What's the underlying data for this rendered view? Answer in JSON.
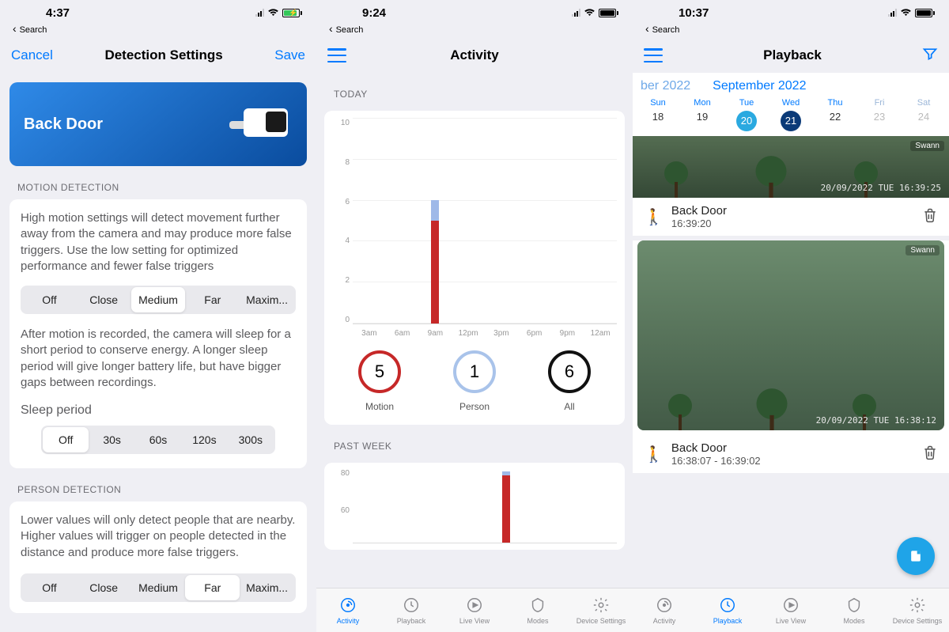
{
  "screen1": {
    "status_time": "4:37",
    "back_link": "Search",
    "nav_cancel": "Cancel",
    "nav_title": "Detection Settings",
    "nav_save": "Save",
    "camera_name": "Back Door",
    "motion": {
      "header": "MOTION DETECTION",
      "desc": "High motion settings will detect movement further away from the camera and may produce more false triggers. Use the low setting for optimized performance and fewer false triggers",
      "options": [
        "Off",
        "Close",
        "Medium",
        "Far",
        "Maxim..."
      ],
      "selected": "Medium",
      "sleep_desc": "After motion is recorded, the camera will sleep for a short period to conserve energy.  A longer sleep period will give longer battery life, but have bigger gaps between recordings.",
      "sleep_label": "Sleep period",
      "sleep_options": [
        "Off",
        "30s",
        "60s",
        "120s",
        "300s"
      ],
      "sleep_selected": "Off"
    },
    "person": {
      "header": "PERSON DETECTION",
      "desc": "Lower values will only detect people that are nearby. Higher values will trigger on people detected in the distance and produce more false triggers.",
      "options": [
        "Off",
        "Close",
        "Medium",
        "Far",
        "Maxim..."
      ],
      "selected": "Far"
    }
  },
  "screen2": {
    "status_time": "9:24",
    "back_link": "Search",
    "nav_title": "Activity",
    "today_header": "TODAY",
    "pastweek_header": "PAST WEEK",
    "stats": {
      "motion": {
        "value": "5",
        "label": "Motion",
        "color": "#c62828"
      },
      "person": {
        "value": "1",
        "label": "Person",
        "color": "#a9c3ea"
      },
      "all": {
        "value": "6",
        "label": "All",
        "color": "#111"
      }
    },
    "tabs": [
      "Activity",
      "Playback",
      "Live View",
      "Modes",
      "Device Settings"
    ],
    "active_tab": "Activity"
  },
  "chart_data": [
    {
      "type": "bar",
      "title": "TODAY",
      "categories": [
        "3am",
        "6am",
        "9am",
        "12pm",
        "3pm",
        "6pm",
        "9pm",
        "12am"
      ],
      "ylim": [
        0,
        10
      ],
      "yticks": [
        0,
        2,
        4,
        6,
        8,
        10
      ],
      "series": [
        {
          "name": "Motion",
          "color": "#c62828",
          "values": [
            0,
            0,
            5,
            0,
            0,
            0,
            0,
            0
          ]
        },
        {
          "name": "Person",
          "color": "#9fb9e8",
          "values": [
            0,
            0,
            1,
            0,
            0,
            0,
            0,
            0
          ]
        }
      ]
    },
    {
      "type": "bar",
      "title": "PAST WEEK",
      "categories": [],
      "ylim": [
        0,
        80
      ],
      "yticks": [
        60,
        80
      ],
      "series": [
        {
          "name": "Motion",
          "color": "#c62828",
          "values": [
            72
          ]
        },
        {
          "name": "Person",
          "color": "#9fb9e8",
          "values": [
            5
          ]
        }
      ]
    }
  ],
  "screen3": {
    "status_time": "10:37",
    "back_link": "Search",
    "nav_title": "Playback",
    "month_prev": "ber 2022",
    "month_curr": "September 2022",
    "days": [
      {
        "dow": "Sun",
        "n": "18",
        "state": "norm"
      },
      {
        "dow": "Mon",
        "n": "19",
        "state": "norm"
      },
      {
        "dow": "Tue",
        "n": "20",
        "state": "circle-light"
      },
      {
        "dow": "Wed",
        "n": "21",
        "state": "circle-dark"
      },
      {
        "dow": "Thu",
        "n": "22",
        "state": "norm"
      },
      {
        "dow": "Fri",
        "n": "23",
        "state": "dim"
      },
      {
        "dow": "Sat",
        "n": "24",
        "state": "dim"
      }
    ],
    "clips": [
      {
        "thumb_ts": "20/09/2022 TUE 16:39:25",
        "name": "Back Door",
        "time": "16:39:20",
        "brand": "Swann",
        "big": false,
        "bg": "#3a4d3f"
      },
      {
        "thumb_ts": "20/09/2022 TUE 16:38:12",
        "name": "Back Door",
        "time": "16:38:07 - 16:39:02",
        "brand": "Swann",
        "big": true,
        "bg": "#6a8b78"
      }
    ],
    "tabs": [
      "Activity",
      "Playback",
      "Live View",
      "Modes",
      "Device Settings"
    ],
    "active_tab": "Playback"
  }
}
